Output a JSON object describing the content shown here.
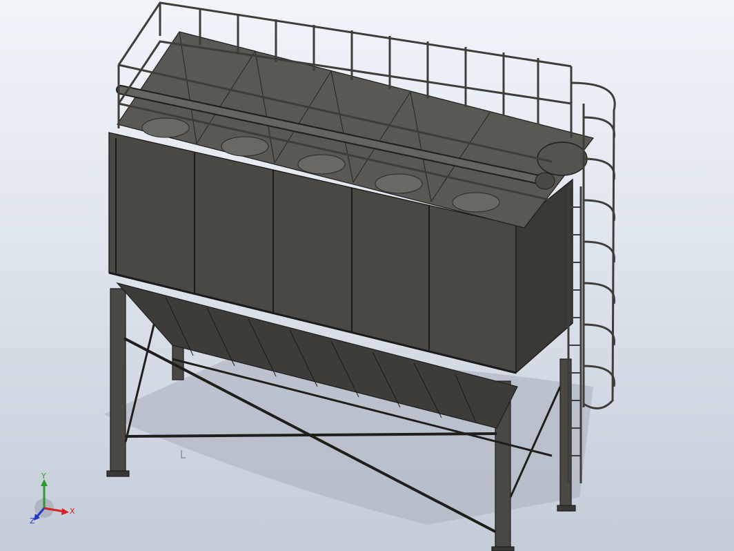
{
  "viewport": {
    "background_top": "#f1f4f9",
    "background_bottom": "#c4ccd8",
    "model_color": "#46443f",
    "edge_color": "#1f1e1b",
    "shadow_color": "#a7aebb"
  },
  "triad": {
    "x_label": "X",
    "y_label": "Y",
    "z_label": "Z",
    "x_color": "#d42222",
    "y_color": "#2a9a2a",
    "z_color": "#2236c9"
  }
}
